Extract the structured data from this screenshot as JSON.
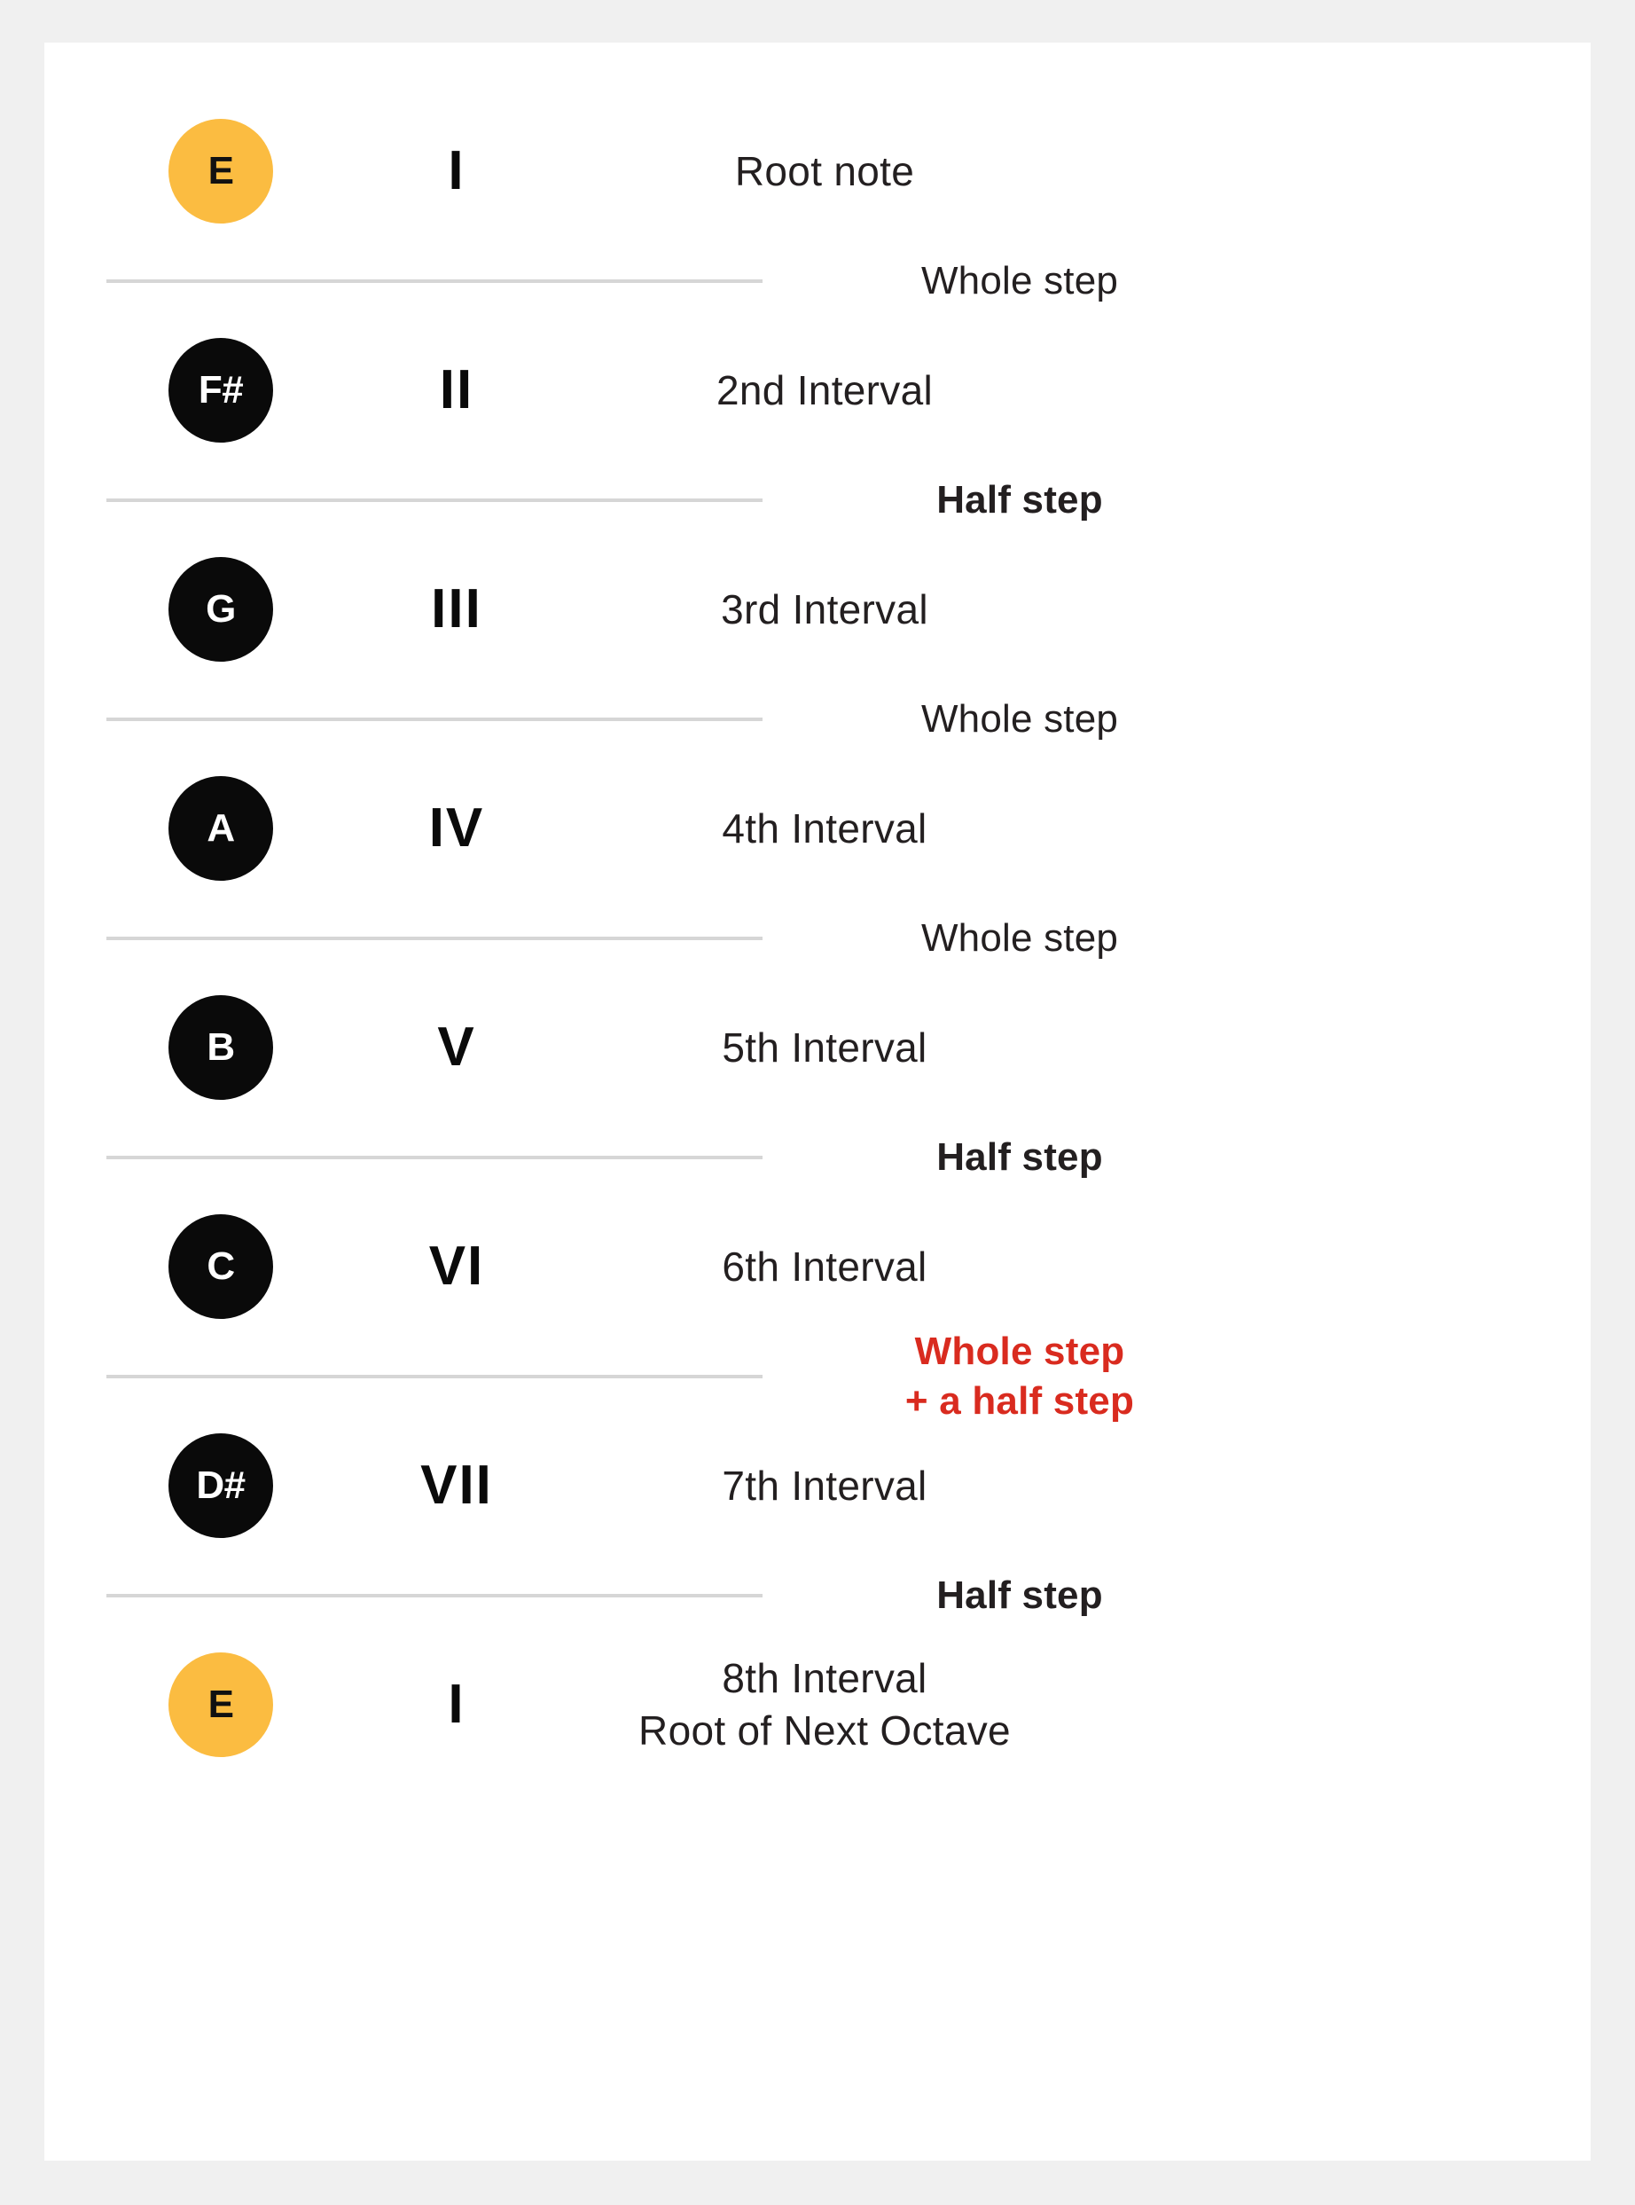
{
  "colors": {
    "background": "#f0f0f0",
    "card": "#ffffff",
    "root_note": "#fbbc41",
    "note": "#0a0a0a",
    "text": "#231f20",
    "accent": "#d92b1f",
    "divider": "#d6d6d6"
  },
  "scale": {
    "rows": [
      {
        "note": "E",
        "numeral": "I",
        "interval": "Root note",
        "interval2": "",
        "is_root": true
      },
      {
        "note": "F#",
        "numeral": "II",
        "interval": "2nd Interval",
        "interval2": "",
        "is_root": false
      },
      {
        "note": "G",
        "numeral": "III",
        "interval": "3rd Interval",
        "interval2": "",
        "is_root": false
      },
      {
        "note": "A",
        "numeral": "IV",
        "interval": "4th Interval",
        "interval2": "",
        "is_root": false
      },
      {
        "note": "B",
        "numeral": "V",
        "interval": "5th Interval",
        "interval2": "",
        "is_root": false
      },
      {
        "note": "C",
        "numeral": "VI",
        "interval": "6th Interval",
        "interval2": "",
        "is_root": false
      },
      {
        "note": "D#",
        "numeral": "VII",
        "interval": "7th Interval",
        "interval2": "",
        "is_root": false
      },
      {
        "note": "E",
        "numeral": "I",
        "interval": "8th Interval",
        "interval2": "Root of Next Octave",
        "is_root": true
      }
    ],
    "steps": [
      {
        "line1": "Whole step",
        "line2": "",
        "emphasis": "whole"
      },
      {
        "line1": "Half step",
        "line2": "",
        "emphasis": "half"
      },
      {
        "line1": "Whole step",
        "line2": "",
        "emphasis": "whole"
      },
      {
        "line1": "Whole step",
        "line2": "",
        "emphasis": "whole"
      },
      {
        "line1": "Half step",
        "line2": "",
        "emphasis": "half"
      },
      {
        "line1": "Whole step",
        "line2": "+ a half step",
        "emphasis": "accent"
      },
      {
        "line1": "Half step",
        "line2": "",
        "emphasis": "half"
      }
    ]
  }
}
